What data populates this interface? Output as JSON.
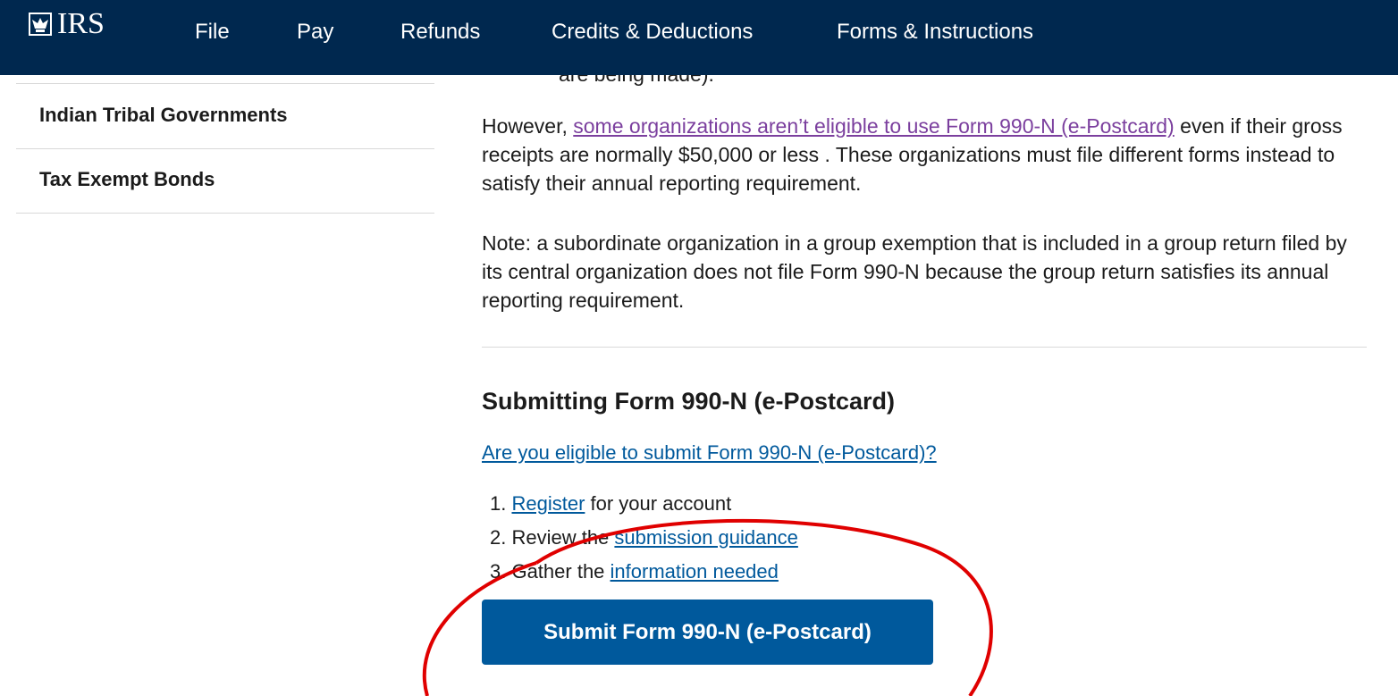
{
  "header": {
    "logo_text": "IRS",
    "logo_icon": "irs-eagle-icon",
    "nav": [
      "File",
      "Pay",
      "Refunds",
      "Credits & Deductions",
      "Forms & Instructions"
    ],
    "background_color": "#00284f"
  },
  "peek_text": "are being made).",
  "sidebar": {
    "items": [
      "Indian Tribal Governments",
      "Tax Exempt Bonds"
    ]
  },
  "main": {
    "para1": {
      "prefix": "However, ",
      "link": "some organizations aren’t eligible to use Form 990-N (e-Postcard)",
      "suffix": " even if their gross receipts are normally $50,000 or less .  These organizations must file different forms instead to satisfy their annual reporting requirement."
    },
    "para2": "Note: a subordinate organization in a group exemption that is included in a group return filed by its central organization does not file Form 990-N because the group return satisfies its annual reporting requirement.",
    "section_title": "Submitting Form 990-N (e-Postcard)",
    "eligibility_link": "Are you eligible to submit Form 990-N (e-Postcard)?",
    "steps": [
      {
        "num": "1. ",
        "link": "Register",
        "text": " for your account"
      },
      {
        "num": "2. Review the ",
        "link": "submission guidance",
        "text": ""
      },
      {
        "num": "3. Gather the ",
        "link": "information needed",
        "text": ""
      }
    ],
    "submit_button": "Submit Form 990-N (e-Postcard)",
    "link_color": "#00599c",
    "visited_link_color": "#7b3f9e",
    "button_color": "#00599c"
  },
  "annotation": {
    "shape": "ellipse",
    "color": "#e00000"
  }
}
